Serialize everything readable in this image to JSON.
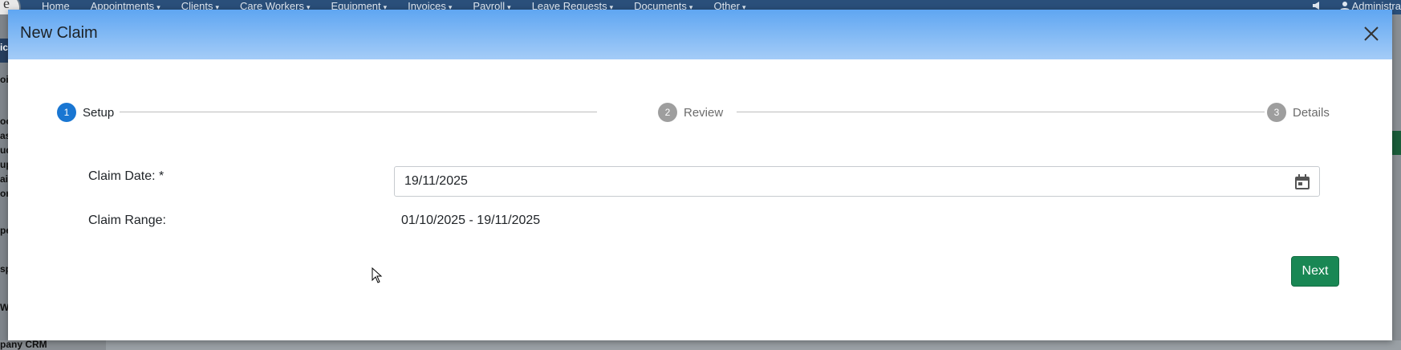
{
  "background": {
    "nav_items": [
      {
        "label": "Home",
        "caret": false
      },
      {
        "label": "Appointments",
        "caret": true
      },
      {
        "label": "Clients",
        "caret": true
      },
      {
        "label": "Care Workers",
        "caret": true
      },
      {
        "label": "Equipment",
        "caret": true
      },
      {
        "label": "Invoices",
        "caret": true
      },
      {
        "label": "Payroll",
        "caret": true
      },
      {
        "label": "Leave Requests",
        "caret": true
      },
      {
        "label": "Documents",
        "caret": true
      },
      {
        "label": "Other",
        "caret": true
      }
    ],
    "user_label": "Administra",
    "logo_letter": "e",
    "bottom_label": "pany CRM",
    "sidebar_fragments": [
      "ic",
      "oi",
      "oo",
      "as",
      "ud",
      "up",
      "ai",
      "on",
      "pe",
      "sp",
      "W"
    ]
  },
  "modal": {
    "title": "New Claim",
    "steps": [
      {
        "number": "1",
        "label": "Setup",
        "active": true
      },
      {
        "number": "2",
        "label": "Review",
        "active": false
      },
      {
        "number": "3",
        "label": "Details",
        "active": false
      }
    ],
    "form": {
      "claim_date_label": "Claim Date: *",
      "claim_date_value": "19/11/2025",
      "claim_range_label": "Claim Range:",
      "claim_range_value": "01/10/2025 - 19/11/2025"
    },
    "next_label": "Next"
  },
  "colors": {
    "header_top": "#5fa6f2",
    "header_bottom": "#a4ccf7",
    "step_active": "#1976d2",
    "step_inactive": "#9e9e9e",
    "next_button": "#198754"
  },
  "icons": {
    "close": "close-icon",
    "calendar": "calendar-icon",
    "megaphone": "megaphone-icon",
    "user": "user-icon"
  }
}
